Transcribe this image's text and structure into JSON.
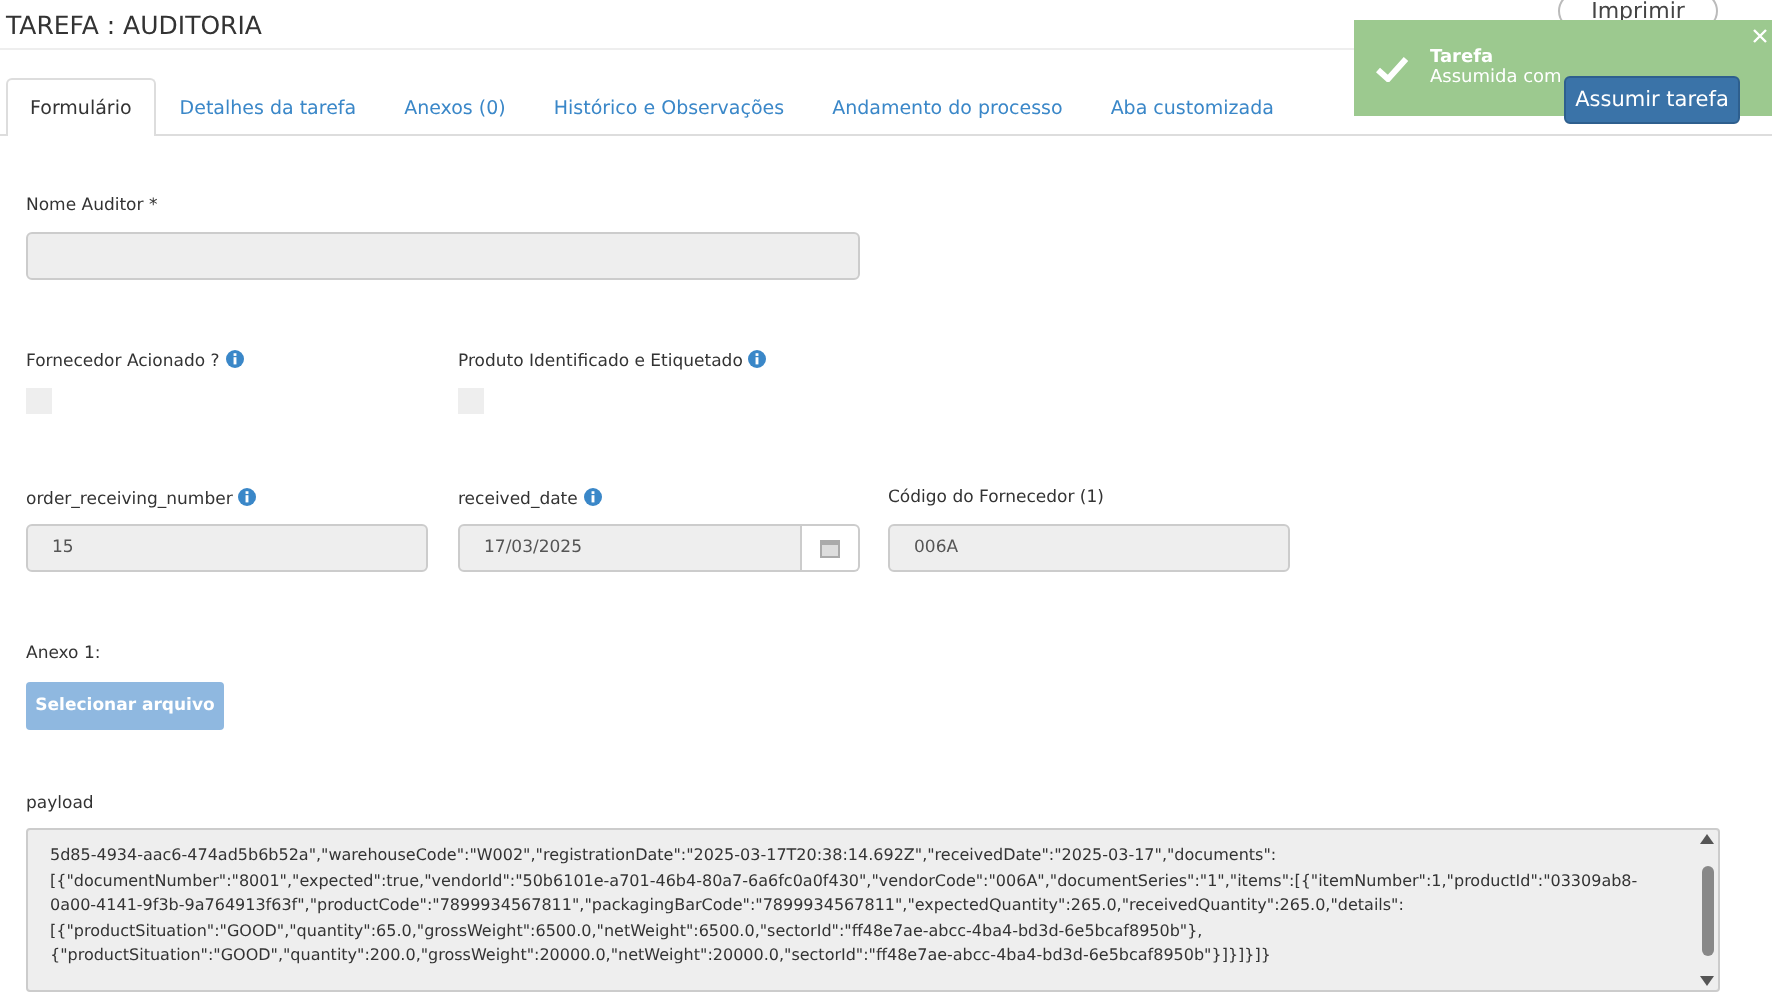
{
  "page_title": "TAREFA : AUDITORIA",
  "print_button": "Imprimir",
  "toast": {
    "title": "Tarefa",
    "message": "Assumida com"
  },
  "tabs": [
    {
      "label": "Formulário",
      "selected": true
    },
    {
      "label": "Detalhes da tarefa",
      "selected": false
    },
    {
      "label": "Anexos (0)",
      "selected": false
    },
    {
      "label": "Histórico e Observações",
      "selected": false
    },
    {
      "label": "Andamento do processo",
      "selected": false
    },
    {
      "label": "Aba customizada",
      "selected": false
    }
  ],
  "assume_button": "Assumir tarefa",
  "fields": [
    {
      "kind": "text",
      "label": "Nome Auditor *"
    },
    {
      "kind": "checkbox",
      "label": "Fornecedor Acionado ?",
      "info": true,
      "checked": false
    },
    {
      "kind": "checkbox",
      "label": "Produto Identificado e Etiquetado",
      "info": true,
      "checked": false
    },
    {
      "kind": "text",
      "label": "order_receiving_number",
      "info": true,
      "value": "15"
    },
    {
      "kind": "date",
      "label": "received_date",
      "info": true,
      "value": "17/03/2025"
    },
    {
      "kind": "text",
      "label": "Código do Fornecedor (1)",
      "value": "006A"
    },
    {
      "kind": "file",
      "label": "Anexo 1:",
      "button": "Selecionar arquivo"
    },
    {
      "kind": "textarea",
      "label": "payload",
      "lines": [
        "5d85-4934-aac6-474ad5b6b52a\",\"warehouseCode\":\"W002\",\"registrationDate\":\"2025-03-17T20:38:14.692Z\",\"receivedDate\":\"2025-03-17\",\"documents\":",
        "[{\"documentNumber\":\"8001\",\"expected\":true,\"vendorId\":\"50b6101e-a701-46b4-80a7-6a6fc0a0f430\",\"vendorCode\":\"006A\",\"documentSeries\":\"1\",\"items\":[{\"itemNumber\":1,\"productId\":\"03309ab8-",
        "0a00-4141-9f3b-9a764913f63f\",\"productCode\":\"7899934567811\",\"packagingBarCode\":\"7899934567811\",\"expectedQuantity\":265.0,\"receivedQuantity\":265.0,\"details\":",
        "[{\"productSituation\":\"GOOD\",\"quantity\":65.0,\"grossWeight\":6500.0,\"netWeight\":6500.0,\"sectorId\":\"ff48e7ae-abcc-4ba4-bd3d-6e5bcaf8950b\"},",
        "{\"productSituation\":\"GOOD\",\"quantity\":200.0,\"grossWeight\":20000.0,\"netWeight\":20000.0,\"sectorId\":\"ff48e7ae-abcc-4ba4-bd3d-6e5bcaf8950b\"}]}]}]}"
      ]
    }
  ]
}
